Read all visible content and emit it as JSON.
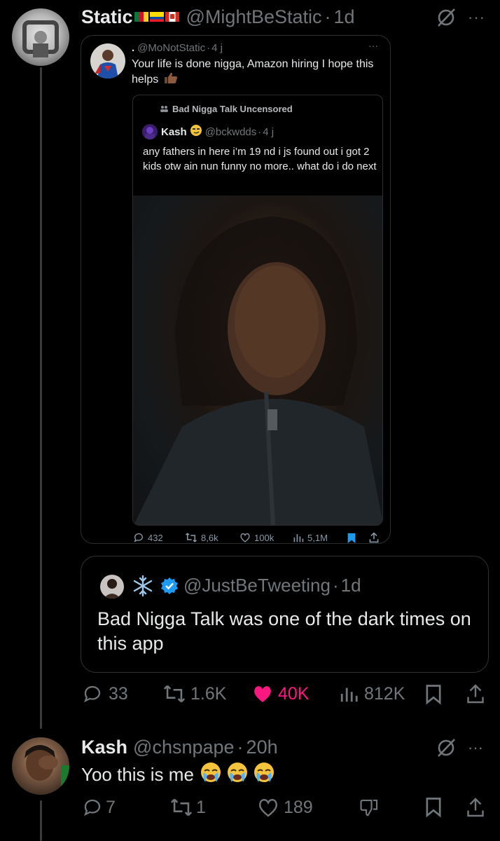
{
  "post1": {
    "display_name": "Static",
    "flags": [
      "cameroon",
      "ecuador",
      "canada"
    ],
    "handle": "@MightBeStatic",
    "dot": "·",
    "time": "1d",
    "quote": {
      "prefix": ".",
      "handle": "@MoNotStatic",
      "dot": "·",
      "time": "4 j",
      "text": "Your life is done nigga, Amazon hiring I hope this helps",
      "emoji": "thumbs-up-dark",
      "inner": {
        "community": "Bad Nigga Talk Uncensored",
        "author": "Kash",
        "handle": "@bckwdds",
        "dot": "·",
        "time": "4 j",
        "text": "any fathers in here i’m 19 nd i js found out i got 2 kids otw ain nun funny no more.. what do i do next"
      },
      "stats": {
        "replies": "432",
        "reposts": "8,6k",
        "likes": "100k",
        "views": "5,1M"
      }
    },
    "quote2": {
      "handle": "@JustBeTweeting",
      "dot": "·",
      "time": "1d",
      "text": "Bad Nigga Talk was one of the dark times on this app"
    },
    "stats": {
      "replies": "33",
      "reposts": "1.6K",
      "likes": "40K",
      "views": "812K"
    }
  },
  "post2": {
    "display_name": "Kash",
    "handle": "@chsnpape",
    "dot": "·",
    "time": "20h",
    "text": "Yoo this is me",
    "stats": {
      "replies": "7",
      "reposts": "1",
      "likes": "189"
    }
  },
  "colors": {
    "background": "#000000",
    "muted": "#71767b",
    "like": "#f91880",
    "verified": "#1d9bf0",
    "bookmark": "#1d9bf0"
  }
}
